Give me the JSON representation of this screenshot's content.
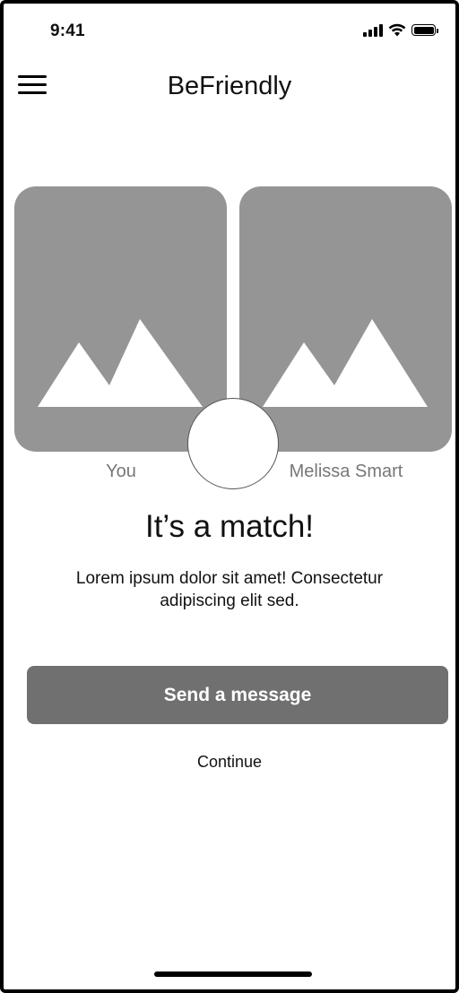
{
  "status_bar": {
    "time": "9:41",
    "icons": [
      "signal-icon",
      "wifi-icon",
      "battery-icon"
    ]
  },
  "header": {
    "menu_icon": "hamburger-menu-icon",
    "title": "BeFriendly"
  },
  "match": {
    "you_photo_icon": "image-placeholder-icon",
    "match_photo_icon": "image-placeholder-icon",
    "you_label": "You",
    "match_name": "Melissa Smart",
    "headline": "It’s a match!",
    "description": "Lorem ipsum dolor sit amet! Consectetur adipiscing elit sed."
  },
  "actions": {
    "send_label": "Send a message",
    "continue_label": "Continue"
  },
  "colors": {
    "photo_placeholder": "#959595",
    "primary_button": "#707070",
    "caption": "#777777"
  }
}
